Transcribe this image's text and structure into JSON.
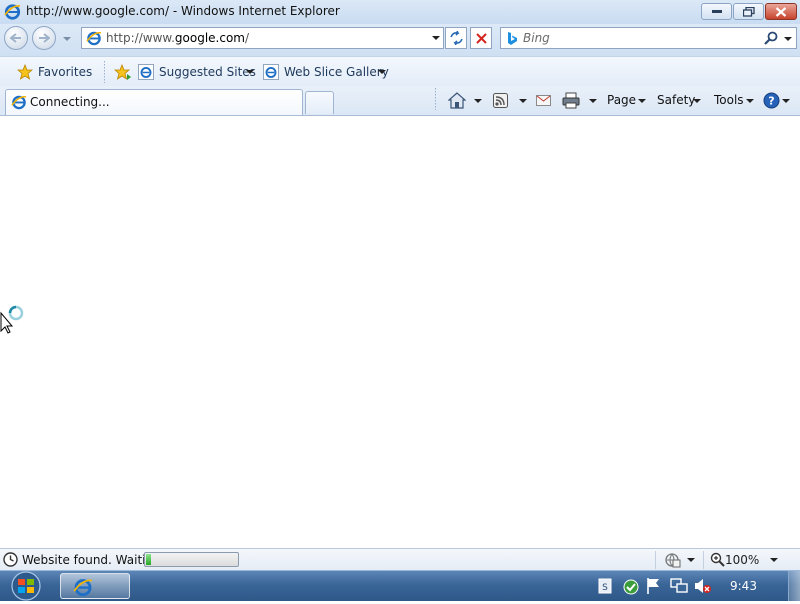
{
  "window": {
    "title": "http://www.google.com/ - Windows Internet Explorer"
  },
  "nav": {
    "address_host_prefix": "http://www.",
    "address_domain": "google.com",
    "address_suffix": "/",
    "search_placeholder": "Bing"
  },
  "favorites_bar": {
    "favorites_label": "Favorites",
    "suggested_sites_label": "Suggested Sites",
    "web_slice_gallery_label": "Web Slice Gallery"
  },
  "tabs": [
    {
      "label": "Connecting..."
    }
  ],
  "command_bar": {
    "page_label": "Page",
    "safety_label": "Safety",
    "tools_label": "Tools"
  },
  "status": {
    "text": "Website found. Waitin",
    "progress_fraction": 0.06,
    "zoom": "100%"
  },
  "taskbar": {
    "clock": "9:43"
  },
  "colors": {
    "accent": "#3a6597",
    "progress_green": "#27a627",
    "close_red": "#c7432c"
  },
  "icons": [
    "ie-icon",
    "back-icon",
    "forward-icon",
    "refresh-icon",
    "stop-icon",
    "bing-icon",
    "search-icon",
    "favorites-star-icon",
    "add-favorites-icon",
    "home-icon",
    "feeds-icon",
    "mail-icon",
    "print-icon",
    "help-icon",
    "zone-icon",
    "zoom-icon",
    "windows-start-icon",
    "busy-cursor-icon"
  ]
}
